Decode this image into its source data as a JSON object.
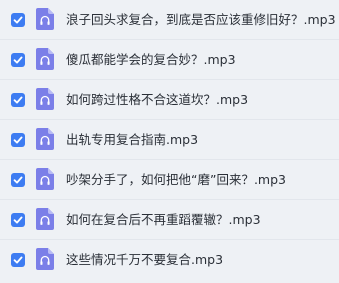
{
  "files": [
    {
      "name": "浪子回头求复合，到底是否应该重修旧好？.mp3",
      "checked": true,
      "icon": "audio-file-icon"
    },
    {
      "name": "傻瓜都能学会的复合妙？.mp3",
      "checked": true,
      "icon": "audio-file-icon"
    },
    {
      "name": "如何跨过性格不合这道坎？.mp3",
      "checked": true,
      "icon": "audio-file-icon"
    },
    {
      "name": "出轨专用复合指南.mp3",
      "checked": true,
      "icon": "audio-file-icon"
    },
    {
      "name": "吵架分手了，如何把他“磨”回来？.mp3",
      "checked": true,
      "icon": "audio-file-icon"
    },
    {
      "name": "如何在复合后不再重蹈覆辙？.mp3",
      "checked": true,
      "icon": "audio-file-icon"
    },
    {
      "name": "这些情况千万不要复合.mp3",
      "checked": true,
      "icon": "audio-file-icon"
    }
  ],
  "colors": {
    "accent": "#3d7cf2",
    "file_icon": "#7b7fe8",
    "background": "#eef1f5"
  }
}
